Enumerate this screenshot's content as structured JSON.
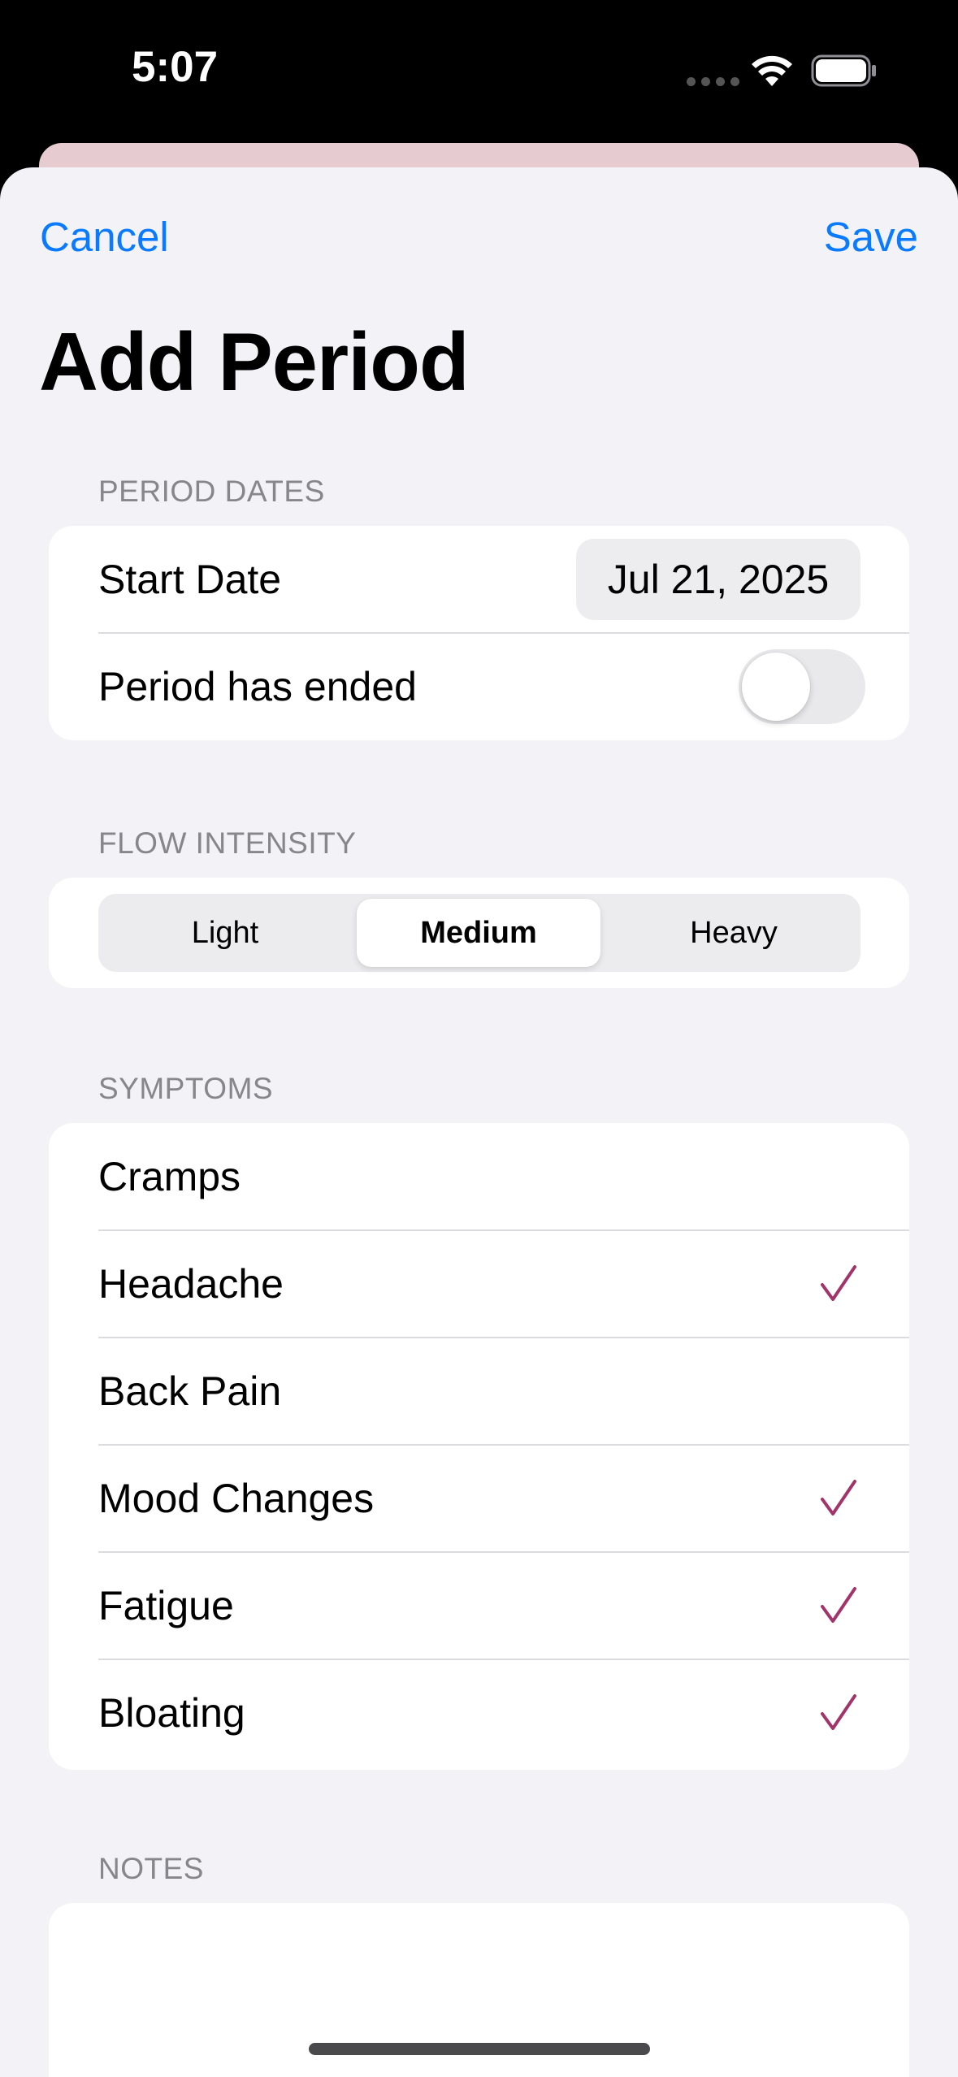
{
  "status_bar": {
    "time": "5:07"
  },
  "nav": {
    "cancel_label": "Cancel",
    "save_label": "Save",
    "accent_color": "#0a7aff"
  },
  "title": "Add Period",
  "period_dates": {
    "header": "PERIOD DATES",
    "start_date_label": "Start Date",
    "start_date_value": "Jul 21, 2025",
    "ended_label": "Period has ended",
    "ended_on": false
  },
  "flow": {
    "header": "FLOW INTENSITY",
    "options": [
      "Light",
      "Medium",
      "Heavy"
    ],
    "selected": "Medium"
  },
  "symptoms": {
    "header": "SYMPTOMS",
    "check_color": "#a3336b",
    "items": [
      {
        "label": "Cramps",
        "checked": false
      },
      {
        "label": "Headache",
        "checked": true
      },
      {
        "label": "Back Pain",
        "checked": false
      },
      {
        "label": "Mood Changes",
        "checked": true
      },
      {
        "label": "Fatigue",
        "checked": true
      },
      {
        "label": "Bloating",
        "checked": true
      }
    ]
  },
  "notes": {
    "header": "NOTES"
  }
}
